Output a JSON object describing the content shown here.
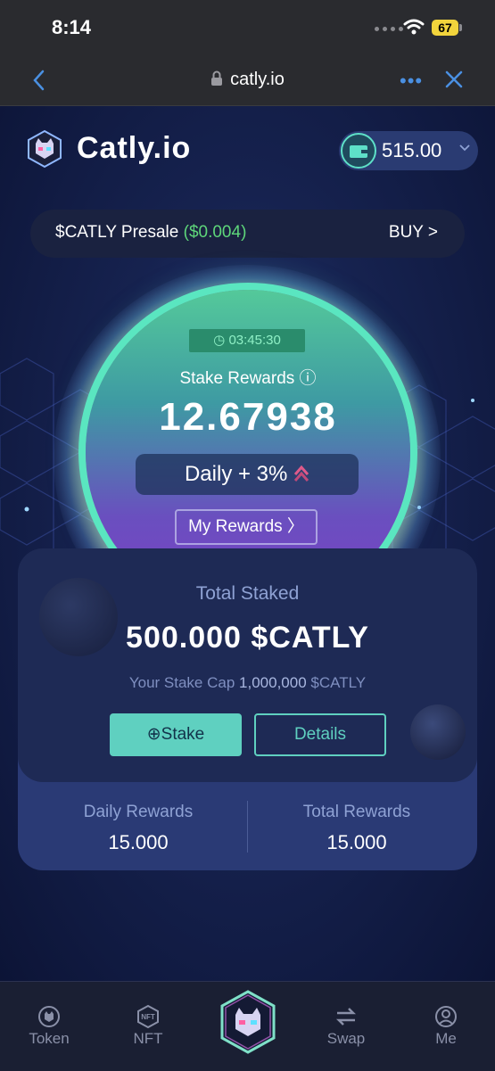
{
  "status": {
    "time": "8:14",
    "battery": "67"
  },
  "browser": {
    "url": "catly.io",
    "more": "•••"
  },
  "header": {
    "brand": "Catly.io",
    "wallet_balance": "515.00"
  },
  "presale": {
    "label": "$CATLY Presale",
    "price": "($0.004)",
    "buy": "BUY >"
  },
  "orb": {
    "timer": "03:45:30",
    "label": "Stake Rewards ⓘ",
    "value": "12.67938",
    "daily": "Daily + 3%",
    "my_rewards": "My Rewards  〉"
  },
  "staked": {
    "label": "Total Staked",
    "value": "500.000 $CATLY",
    "cap_prefix": "Your Stake Cap",
    "cap_amount": "1,000,000",
    "cap_suffix": "$CATLY",
    "stake_button": "⊕Stake",
    "details_button": "Details"
  },
  "rewards": {
    "daily_label": "Daily Rewards",
    "daily_value": "15.000",
    "total_label": "Total Rewards",
    "total_value": "15.000"
  },
  "tabs": [
    {
      "label": "Token",
      "icon": "cat-coin-icon"
    },
    {
      "label": "NFT",
      "icon": "nft-icon"
    },
    {
      "label": "",
      "icon": "cat-hex-icon"
    },
    {
      "label": "Swap",
      "icon": "swap-icon"
    },
    {
      "label": "Me",
      "icon": "user-icon"
    }
  ],
  "colors": {
    "accent": "#5fd0c0",
    "price_green": "#5ed67a",
    "battery": "#f2d43c"
  }
}
